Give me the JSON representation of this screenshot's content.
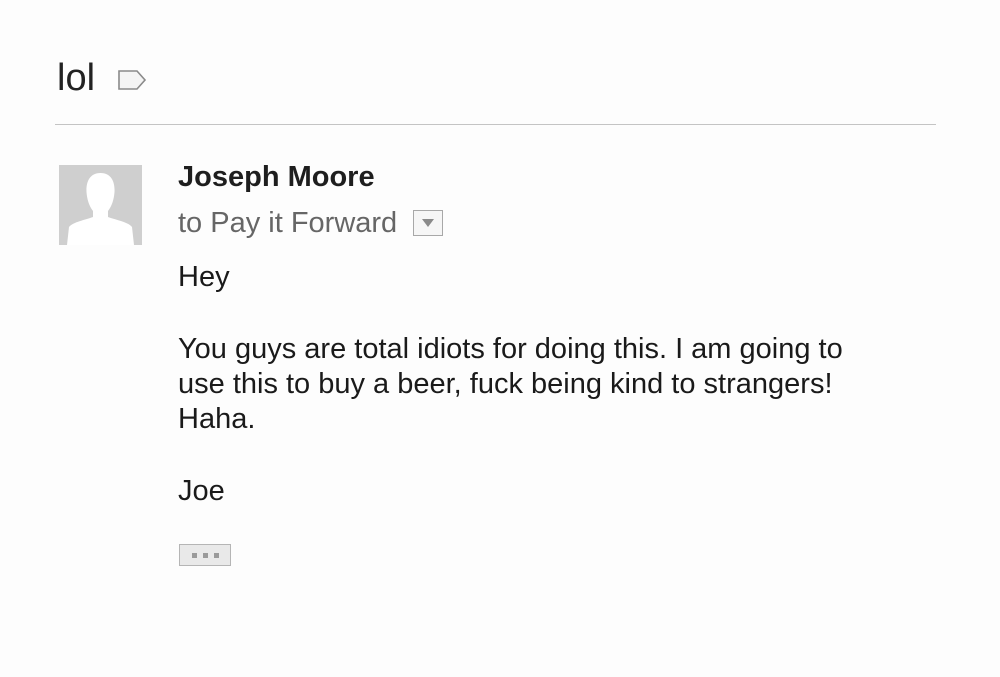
{
  "email": {
    "subject": "lol",
    "sender_name": "Joseph Moore",
    "recipient_line": "to Pay it Forward",
    "body": {
      "greeting": "Hey",
      "line1": "You guys are total idiots for doing this. I am going to",
      "line2": "use this to buy a beer, fuck being kind to strangers!",
      "line3": "Haha.",
      "signature": "Joe"
    }
  },
  "icons": {
    "label": "label-tag-icon",
    "avatar": "default-person-avatar",
    "details": "triangle-down-icon",
    "show_trimmed": "ellipsis-icon"
  },
  "colors": {
    "background": "#fdfdfd",
    "divider": "#c4c4c4",
    "avatar_bg": "#cfcfcf",
    "muted_text": "#666666"
  }
}
